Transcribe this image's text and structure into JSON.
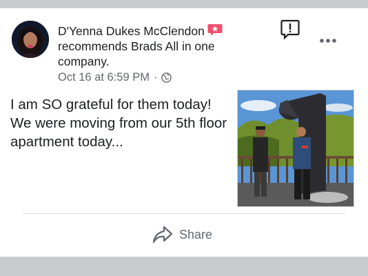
{
  "post": {
    "author": "D'Yenna Dukes McClendon",
    "action_text": "recommends",
    "page_name": "Brads All in one company",
    "period": ".",
    "timestamp": "Oct 16 at 6:59 PM",
    "separator": "·",
    "body": "I am SO grateful for them today!  We were moving from our 5th floor apartment today...",
    "share_label": "Share"
  },
  "icons": {
    "recommend_badge": "recommend-icon",
    "privacy": "globe-icon",
    "report": "report-icon",
    "more": "more-icon",
    "share": "share-icon"
  },
  "colors": {
    "recommend_badge": "#f0506e",
    "meta_text": "#65676b",
    "band": "#c9cbcf"
  }
}
